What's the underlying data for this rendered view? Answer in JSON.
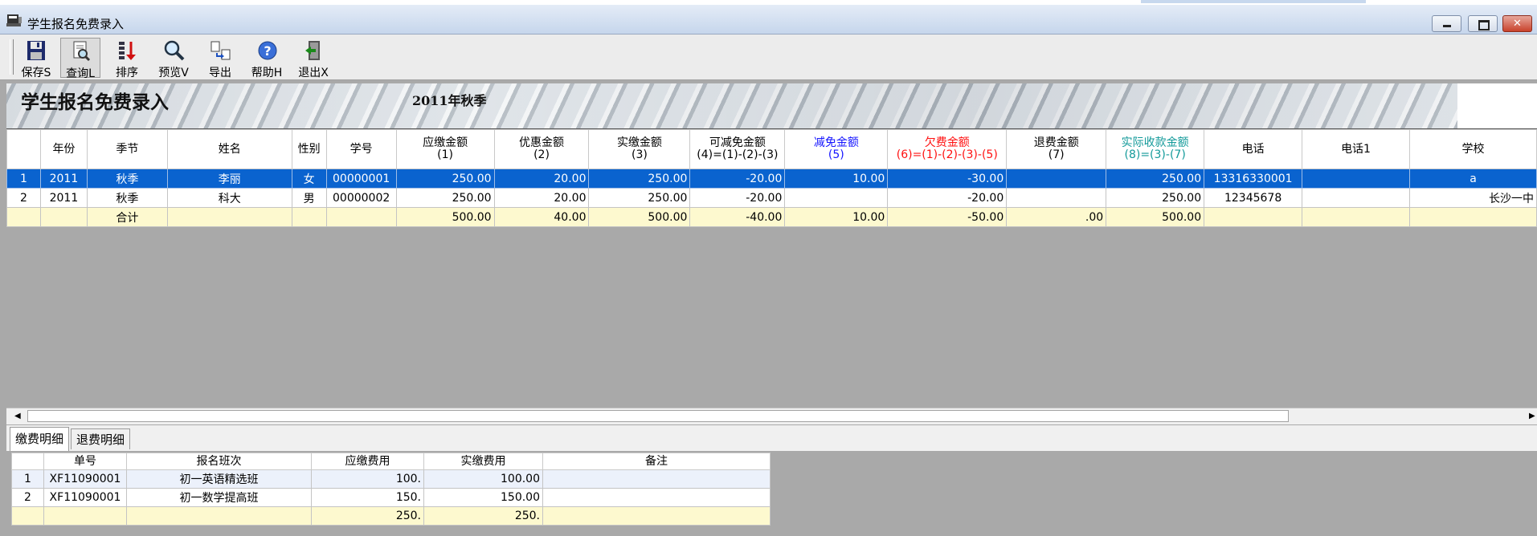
{
  "window": {
    "title": "学生报名免费录入"
  },
  "toolbar": {
    "buttons": [
      {
        "key": "save",
        "label": "保存S"
      },
      {
        "key": "query",
        "label": "查询L"
      },
      {
        "key": "sort",
        "label": "排序"
      },
      {
        "key": "preview",
        "label": "预览V"
      },
      {
        "key": "export",
        "label": "导出"
      },
      {
        "key": "help",
        "label": "帮助H"
      },
      {
        "key": "exit",
        "label": "退出X"
      }
    ]
  },
  "banner": {
    "title": "学生报名免费录入",
    "semester": "2011年秋季"
  },
  "grid": {
    "headers": {
      "year": "年份",
      "season": "季节",
      "name": "姓名",
      "gender": "性别",
      "student_no": "学号",
      "payable": "应缴金额",
      "payable_sub": "(1)",
      "discount": "优惠金额",
      "discount_sub": "(2)",
      "paid": "实缴金额",
      "paid_sub": "(3)",
      "reducible": "可减免金额",
      "reducible_sub": "(4)=(1)-(2)-(3)",
      "reduced": "减免金额",
      "reduced_sub": "(5)",
      "owed": "欠费金额",
      "owed_sub": "(6)=(1)-(2)-(3)-(5)",
      "refund": "退费金额",
      "refund_sub": "(7)",
      "actual": "实际收款金额",
      "actual_sub": "(8)=(3)-(7)",
      "phone": "电话",
      "phone1": "电话1",
      "school": "学校"
    },
    "rows": [
      {
        "idx": "1",
        "year": "2011",
        "season": "秋季",
        "name": "李丽",
        "gender": "女",
        "student_no": "00000001",
        "payable": "250.00",
        "discount": "20.00",
        "paid": "250.00",
        "reducible": "-20.00",
        "reduced": "10.00",
        "owed": "-30.00",
        "refund": "",
        "actual": "250.00",
        "phone": "13316330001",
        "phone1": "",
        "school": "a"
      },
      {
        "idx": "2",
        "year": "2011",
        "season": "秋季",
        "name": "科大",
        "gender": "男",
        "student_no": "00000002",
        "payable": "250.00",
        "discount": "20.00",
        "paid": "250.00",
        "reducible": "-20.00",
        "reduced": "",
        "owed": "-20.00",
        "refund": "",
        "actual": "250.00",
        "phone": "12345678",
        "phone1": "",
        "school": "长沙一中"
      }
    ],
    "total": {
      "label": "合计",
      "payable": "500.00",
      "discount": "40.00",
      "paid": "500.00",
      "reducible": "-40.00",
      "reduced": "10.00",
      "owed": "-50.00",
      "refund": ".00",
      "actual": "500.00"
    }
  },
  "tabs": {
    "payment_details": "缴费明细",
    "refund_details": "退费明细"
  },
  "details": {
    "headers": {
      "bill_no": "单号",
      "class": "报名班次",
      "payable_fee": "应缴费用",
      "paid_fee": "实缴费用",
      "note": "备注"
    },
    "rows": [
      {
        "idx": "1",
        "bill_no": "XF11090001",
        "class": "初一英语精选班",
        "payable_fee": "100.",
        "paid_fee": "100.00",
        "note": ""
      },
      {
        "idx": "2",
        "bill_no": "XF11090001",
        "class": "初一数学提高班",
        "payable_fee": "150.",
        "paid_fee": "150.00",
        "note": ""
      }
    ],
    "total": {
      "payable_fee": "250.",
      "paid_fee": "250."
    }
  },
  "colors": {
    "selected_row": "#0a63cf",
    "total_row": "#fdf9cf",
    "reduced_header": "#1515ff",
    "owed_header": "#ff1010",
    "actual_header": "#139a9a"
  }
}
